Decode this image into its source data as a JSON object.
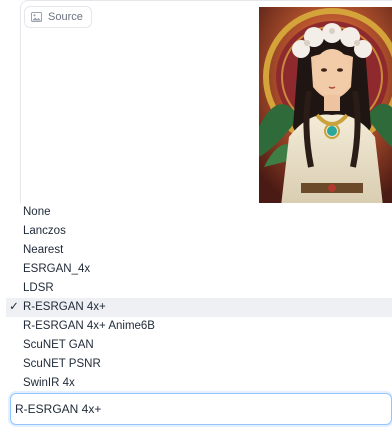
{
  "source": {
    "label": "Source",
    "icon": "image-icon"
  },
  "upscaler": {
    "options": [
      {
        "label": "None",
        "selected": false
      },
      {
        "label": "Lanczos",
        "selected": false
      },
      {
        "label": "Nearest",
        "selected": false
      },
      {
        "label": "ESRGAN_4x",
        "selected": false
      },
      {
        "label": "LDSR",
        "selected": false
      },
      {
        "label": "R-ESRGAN 4x+",
        "selected": true
      },
      {
        "label": "R-ESRGAN 4x+ Anime6B",
        "selected": false
      },
      {
        "label": "ScuNET GAN",
        "selected": false
      },
      {
        "label": "ScuNET PSNR",
        "selected": false
      },
      {
        "label": "SwinIR 4x",
        "selected": false
      }
    ],
    "check_mark": "✓",
    "value": "R-ESRGAN 4x+"
  }
}
